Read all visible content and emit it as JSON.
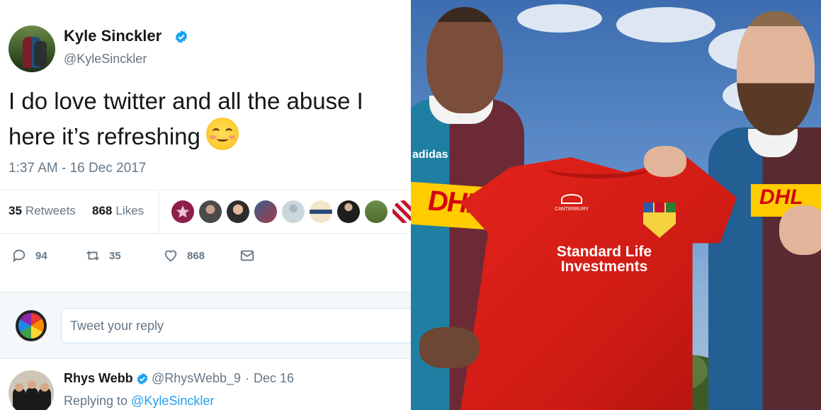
{
  "tweet": {
    "author_name": "Kyle Sinckler",
    "author_handle": "@KyleSinckler",
    "text_line1": "I do love twitter and all the abuse I",
    "text_line2": "here it’s refreshing",
    "emoji": "smiling-face-with-smiling-eyes",
    "timestamp": "1:37 AM - 16 Dec 2017",
    "stats": {
      "retweets_count": "35",
      "retweets_label": "Retweets",
      "likes_count": "868",
      "likes_label": "Likes"
    },
    "actions": {
      "reply_count": "94",
      "retweet_count": "35",
      "like_count": "868"
    }
  },
  "reply_box": {
    "placeholder": "Tweet your reply"
  },
  "reply_tweet": {
    "author_name": "Rhys Webb",
    "author_handle": "@RhysWebb_9",
    "separator": "·",
    "date": "Dec 16",
    "replying_to_label": "Replying to",
    "replying_to_handle": "@KyleSinckler"
  },
  "photo": {
    "jersey_sponsor_line1": "Standard Life",
    "jersey_sponsor_line2": "Investments",
    "shirt_sponsor": "DHL",
    "kit_brand": "adidas",
    "jersey_brand": "CANTERBURY"
  },
  "colors": {
    "link_blue": "#1da1f2",
    "text_secondary": "#657786",
    "jersey_red": "#e2231a",
    "dhl_yellow": "#ffcc00",
    "dhl_red": "#d40511"
  }
}
